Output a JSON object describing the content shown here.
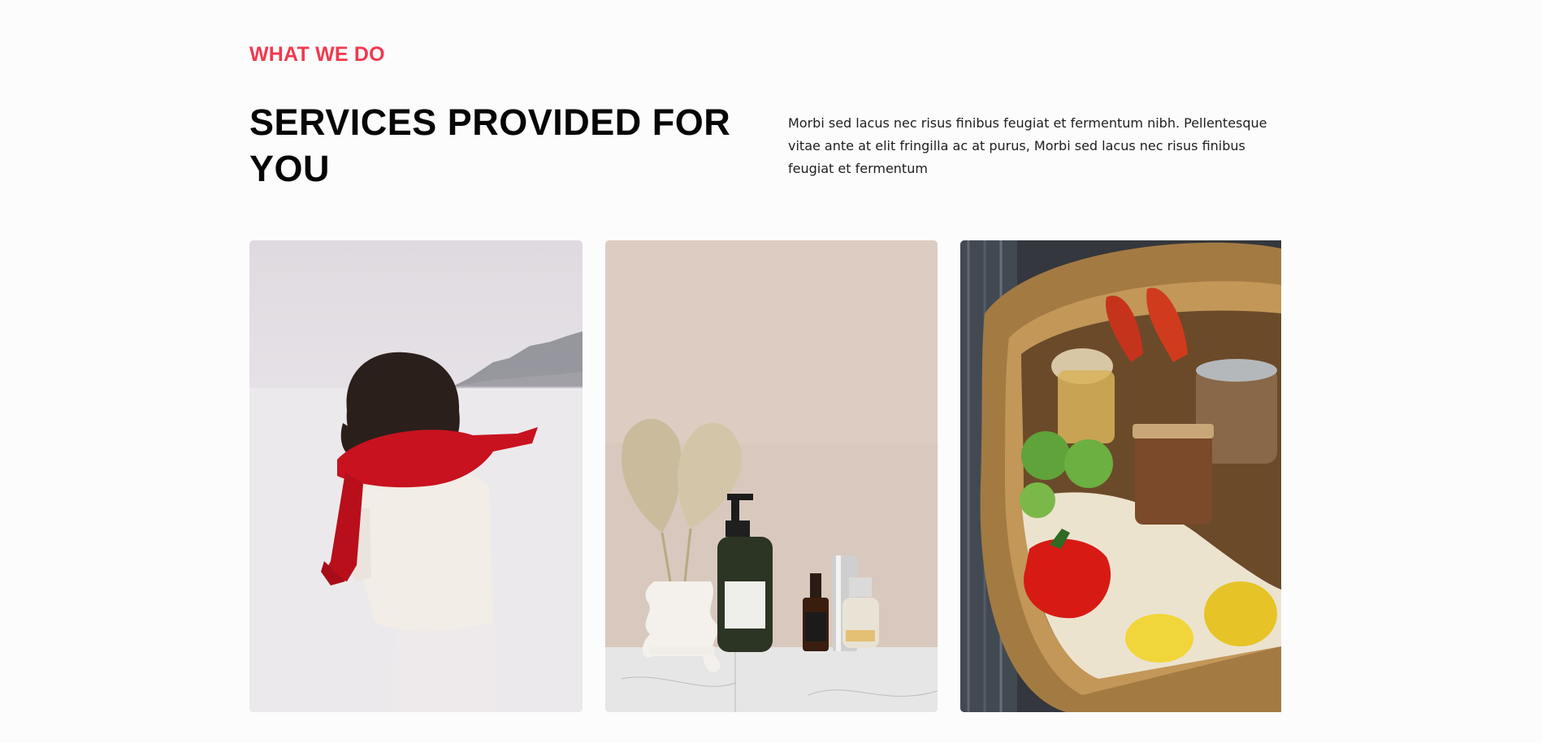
{
  "section": {
    "eyebrow": "WHAT WE DO",
    "title": "SERVICES PROVIDED FOR YOU",
    "description": "Morbi sed lacus nec risus finibus feugiat et fermentum nibh. Pellentesque vitae ante at elit fringilla ac at purus, Morbi sed lacus nec risus finibus feugiat et fermentum"
  },
  "colors": {
    "accent": "#f0394f",
    "heading": "#060606",
    "body_text": "#1e1e1e",
    "background": "#fcfcfc"
  },
  "cards": [
    {
      "image": "woman-red-scarf-snow-photo"
    },
    {
      "image": "skincare-bottles-vase-photo"
    },
    {
      "image": "grocery-basket-photo"
    }
  ]
}
